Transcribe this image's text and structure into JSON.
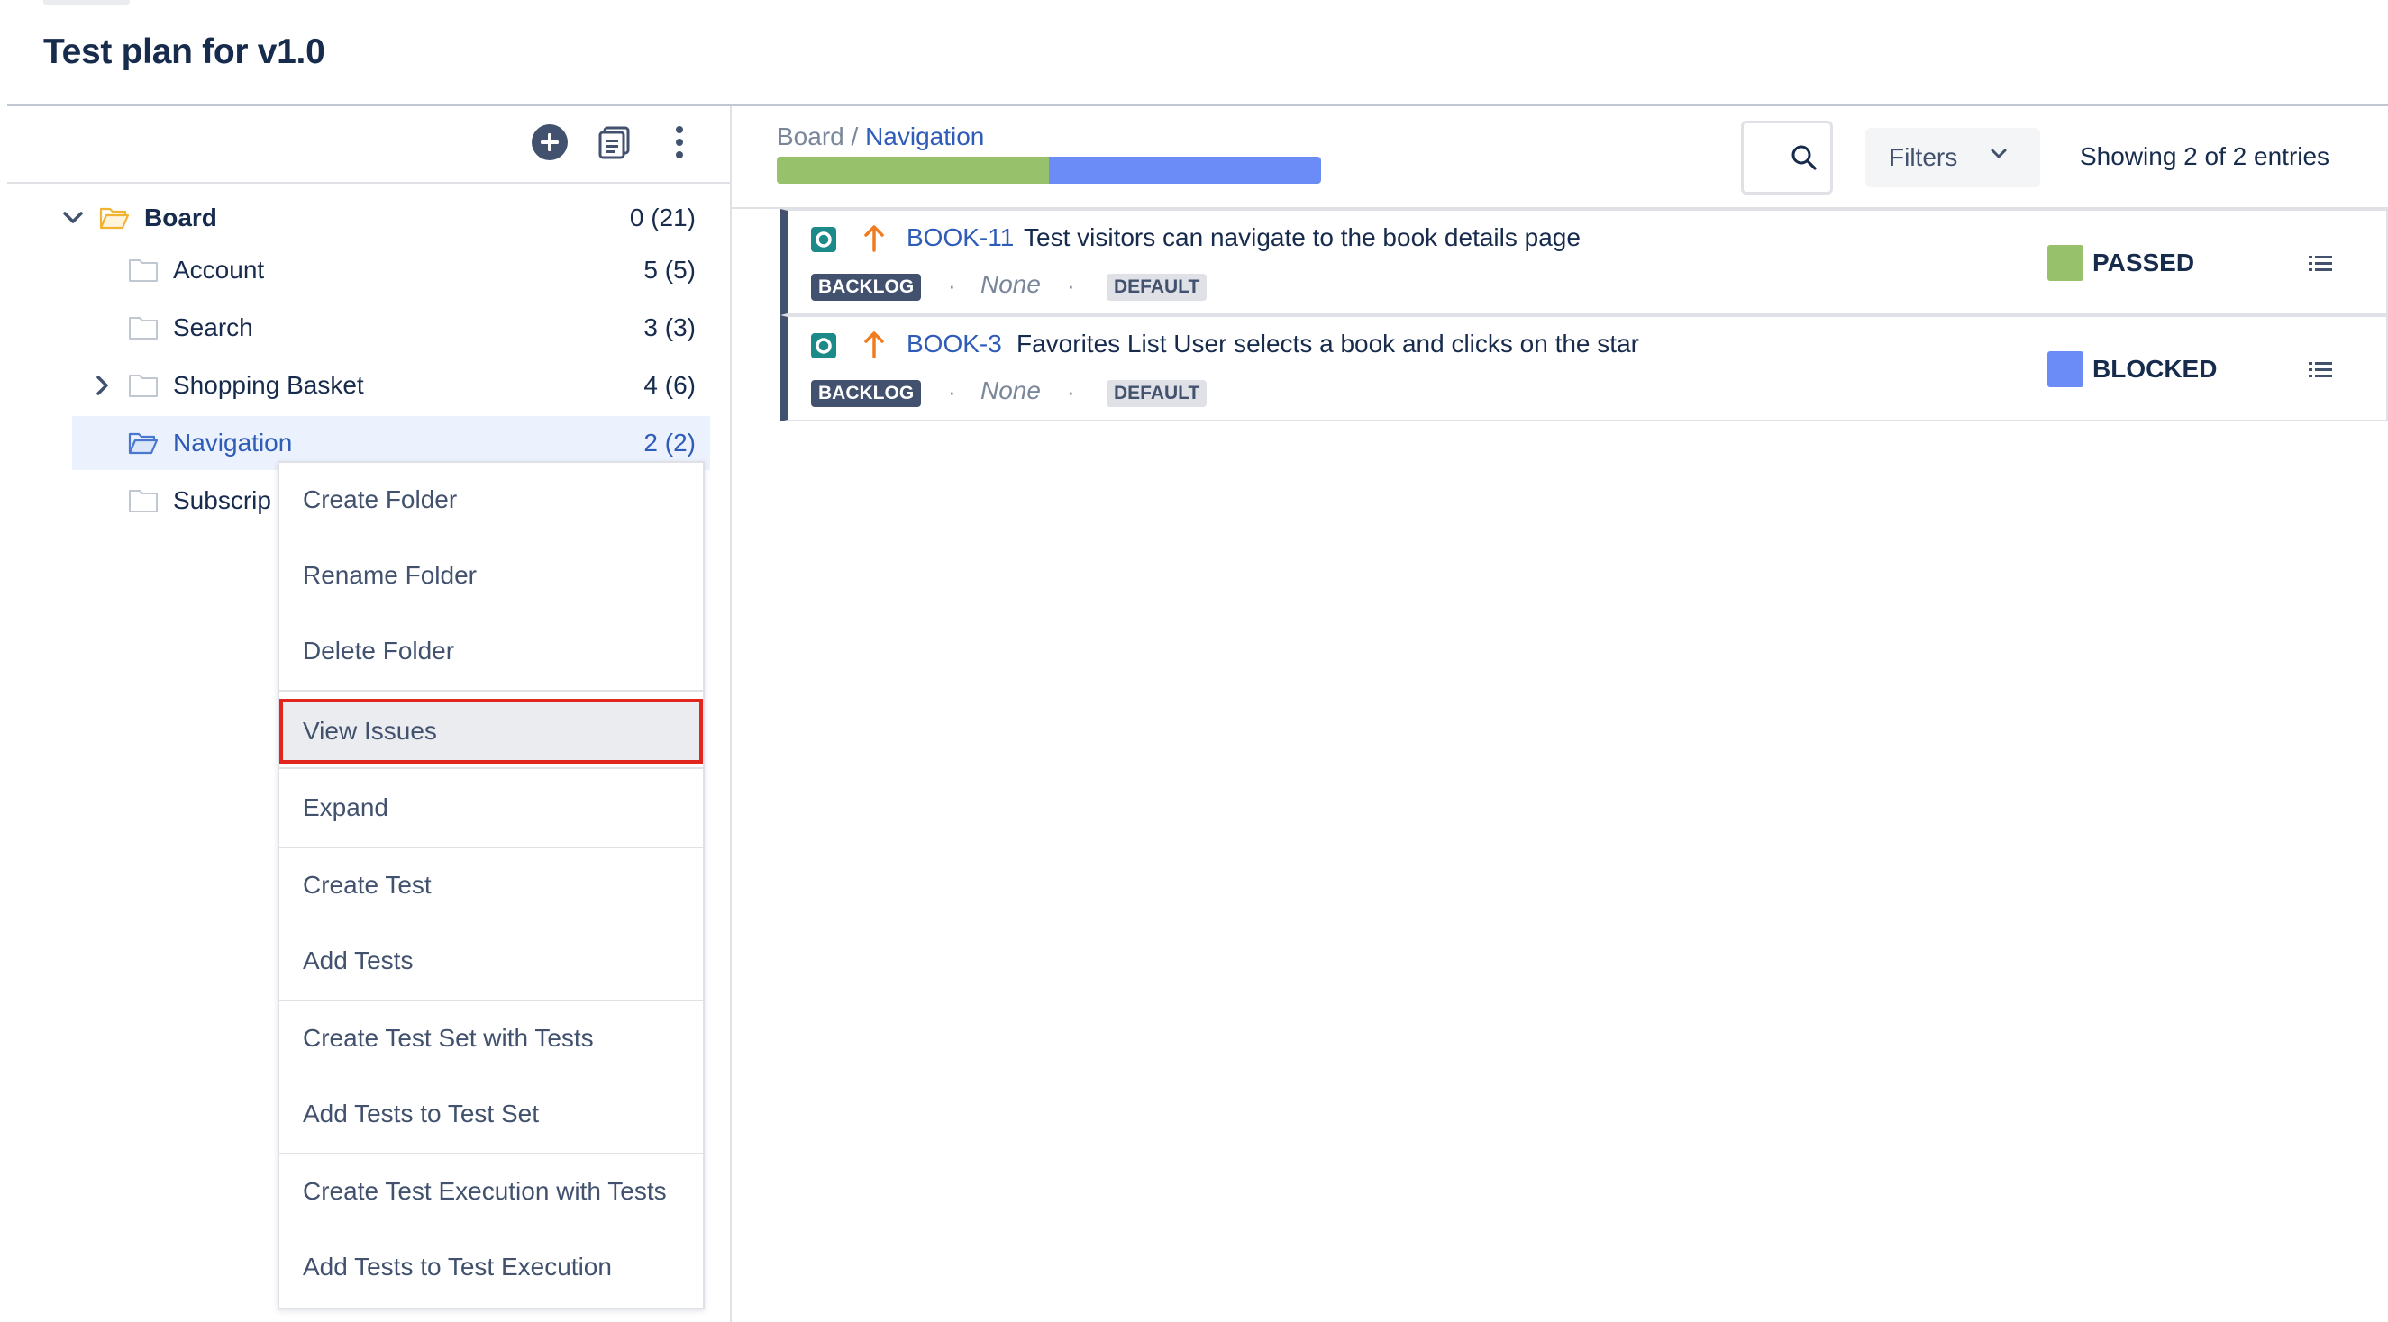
{
  "page": {
    "title": "Test plan for v1.0"
  },
  "tree": {
    "toolbar": {
      "add_icon": "plus-circle-icon",
      "docs_icon": "documents-icon",
      "more_icon": "more-vertical-icon"
    },
    "items": [
      {
        "label": "Board",
        "count": "0 (21)",
        "expanded": true,
        "root": true
      },
      {
        "label": "Account",
        "count": "5 (5)"
      },
      {
        "label": "Search",
        "count": "3 (3)"
      },
      {
        "label": "Shopping Basket",
        "count": "4 (6)",
        "has_children": true
      },
      {
        "label": "Navigation",
        "count": "2 (2)",
        "selected": true
      },
      {
        "label": "Subscrip",
        "count": ""
      }
    ]
  },
  "context_menu": {
    "items": [
      "Create Folder",
      "Rename Folder",
      "Delete Folder",
      "View Issues",
      "Expand",
      "Create Test",
      "Add Tests",
      "Create Test Set with Tests",
      "Add Tests to Test Set",
      "Create Test Execution with Tests",
      "Add Tests to Test Execution"
    ],
    "highlighted": "View Issues"
  },
  "content": {
    "breadcrumb": {
      "root": "Board",
      "separator": " / ",
      "current": "Navigation"
    },
    "progress": [
      {
        "status": "PASSED",
        "fraction": 0.5,
        "color": "#98c16b"
      },
      {
        "status": "BLOCKED",
        "fraction": 0.5,
        "color": "#6b8cf6"
      }
    ],
    "filters_label": "Filters",
    "showing_text": "Showing 2 of 2 entries",
    "issues": [
      {
        "key": "BOOK-11",
        "summary": "Test visitors can navigate to the book details page",
        "status_lozenge": "BACKLOG",
        "assignee": "None",
        "env_lozenge": "DEFAULT",
        "test_status": "PASSED",
        "status_color": "#98c16b"
      },
      {
        "key": "BOOK-3",
        "summary": "Favorites List User selects a book and clicks on the star",
        "status_lozenge": "BACKLOG",
        "assignee": "None",
        "env_lozenge": "DEFAULT",
        "test_status": "BLOCKED",
        "status_color": "#6b8cf6"
      }
    ]
  },
  "colors": {
    "link": "#2e5cb8",
    "priority": "#f07c22",
    "test_type": "#1d8a8a",
    "highlight_border": "#e0261f"
  }
}
